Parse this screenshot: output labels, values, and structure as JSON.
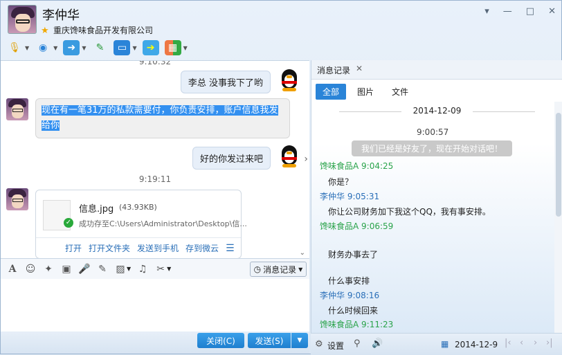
{
  "contact": {
    "name": "李仲华",
    "company": "重庆馋味食品开发有限公司"
  },
  "toolbar": {
    "icons": [
      "microphone-icon",
      "camera-icon",
      "folder-transfer-icon",
      "add-note-icon",
      "screen-share-icon",
      "remote-assist-icon",
      "apps-icon"
    ]
  },
  "window_controls": {
    "pin": "▾",
    "minimize": "—",
    "maximize": "□",
    "close": "✕"
  },
  "chat": {
    "ts_top": "9:10:32",
    "msg1": "李总 没事我下了哟",
    "msg2": "现在有一笔31万的私款需要付，你负责安排，账户信息我发给你",
    "msg3": "好的你发过来吧",
    "ts2": "9:19:11",
    "file": {
      "name": "信息.jpg",
      "size": "(43.93KB)",
      "status": "成功存至C:\\Users\\Administrator\\Desktop\\信...",
      "actions": [
        "打开",
        "打开文件夹",
        "发送到手机",
        "存到微云"
      ]
    }
  },
  "input_toolbar": {
    "history_label": "消息记录"
  },
  "footer": {
    "close_label": "关闭(C)",
    "send_label": "发送(S)"
  },
  "history": {
    "tab_label": "消息记录",
    "filters": [
      "全部",
      "图片",
      "文件"
    ],
    "date": "2014-12-09",
    "first_time": "9:00:57",
    "system_msg": "我们已经是好友了，现在开始对话吧！",
    "entries": [
      {
        "sender": "馋味食品A",
        "time": "9:04:25",
        "color": "#2aa34a"
      },
      {
        "text": "你是？"
      },
      {
        "sender": "李仲华",
        "time": "9:05:31",
        "color": "#2a6fb8"
      },
      {
        "text": "你让公司财务加下我这个QQ，我有事安排。"
      },
      {
        "sender": "馋味食品A",
        "time": "9:06:59",
        "color": "#2aa34a"
      },
      {
        "text": "财务办事去了"
      },
      {
        "text": "什么事安排"
      },
      {
        "sender": "李仲华",
        "time": "9:08:16",
        "color": "#2a6fb8"
      },
      {
        "text": "什么时候回来"
      },
      {
        "sender": "馋味食品A",
        "time": "9:11:23",
        "color": "#2aa34a"
      }
    ],
    "footer": {
      "settings_label": "设置",
      "date": "2014-12-9"
    }
  }
}
